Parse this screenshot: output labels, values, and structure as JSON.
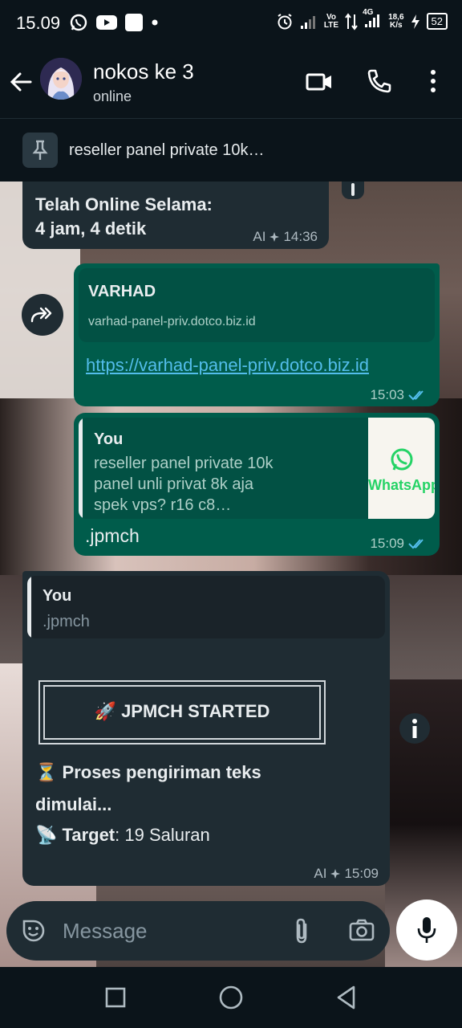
{
  "status_bar": {
    "time": "15.09",
    "net_speed_top": "18,6",
    "net_speed_bottom": "K/s",
    "volte_top": "Vo",
    "volte_bottom": "LTE",
    "network_type": "4G",
    "battery": "52"
  },
  "header": {
    "contact_name": "nokos ke 3",
    "contact_status": "online"
  },
  "pinned": {
    "text": "reseller panel private 10k…"
  },
  "messages": {
    "m1": {
      "line1": "Telah Online Selama:",
      "line2": "4 jam, 4 detik",
      "ai_label": "AI",
      "time": "14:36"
    },
    "m2": {
      "preview_title": "VARHAD",
      "preview_domain": "varhad-panel-priv.dotco.biz.id",
      "link": "https://varhad-panel-priv.dotco.biz.id",
      "time": "15:03"
    },
    "m3": {
      "quote_author": "You",
      "quote_line1": "reseller panel private 10k",
      "quote_line2": "panel unli privat 8k aja",
      "quote_line3": "spek vps? r16 c8…",
      "thumb_text": "WhatsApp",
      "text": ".jpmch",
      "time": "15:09"
    },
    "m4": {
      "quote_author": "You",
      "quote_text": ".jpmch",
      "banner_icon": "🚀",
      "banner_text": "JPMCH STARTED",
      "proses_icon": "⏳",
      "proses_line1": "Proses pengiriman teks",
      "proses_line2": "dimulai...",
      "target_icon": "📡",
      "target_label": "Target",
      "target_value": ": 19 Saluran",
      "ai_label": "AI",
      "time": "15:09"
    }
  },
  "input": {
    "placeholder": "Message"
  },
  "colors": {
    "incoming_bubble": "#1f2c33",
    "outgoing_bubble": "#005c4b",
    "link": "#53bdeb",
    "read_ticks": "#53bdeb",
    "app_bar": "#0b141a"
  }
}
